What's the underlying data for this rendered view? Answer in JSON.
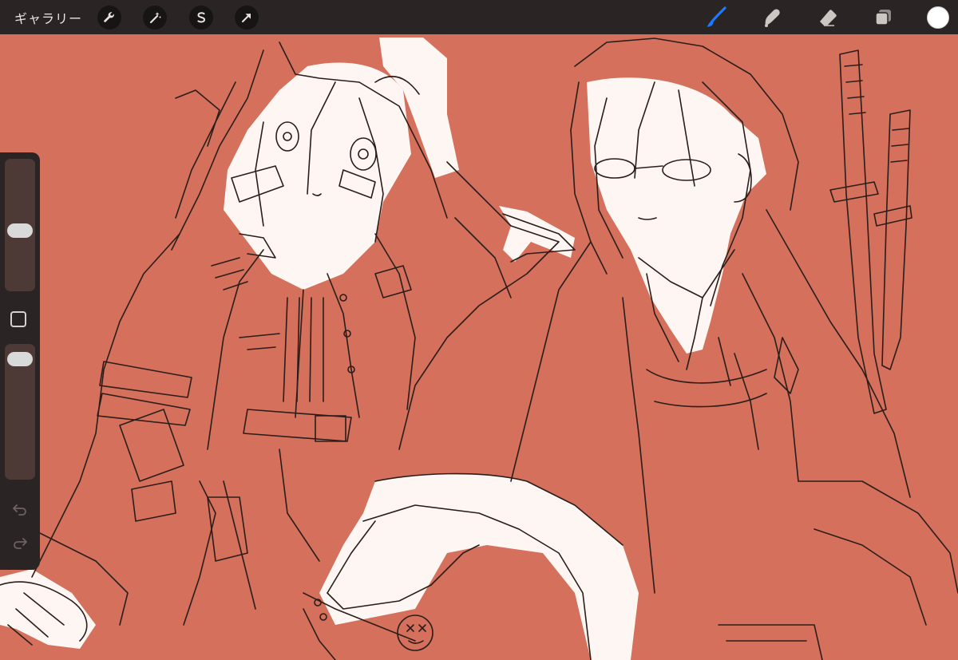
{
  "toolbar": {
    "gallery_label": "ギャラリー",
    "left_tools": [
      "wrench-icon",
      "magic-wand-icon",
      "selection-icon",
      "transform-arrow-icon"
    ],
    "right_tools": [
      "brush-icon",
      "smudge-icon",
      "eraser-icon",
      "layers-icon"
    ],
    "active_tool": "brush-icon",
    "active_color": "#ffffff",
    "accent": "#1a7bff"
  },
  "sidebar": {
    "brush_size_level": 0.45,
    "opacity_level": 0.05,
    "controls": [
      "brush-size-slider",
      "modifier-button",
      "opacity-slider",
      "undo-icon",
      "redo-icon"
    ]
  },
  "canvas": {
    "background": "#d4705c",
    "line_color": "#2b1d1a",
    "fill_color": "#fdf6f2"
  }
}
